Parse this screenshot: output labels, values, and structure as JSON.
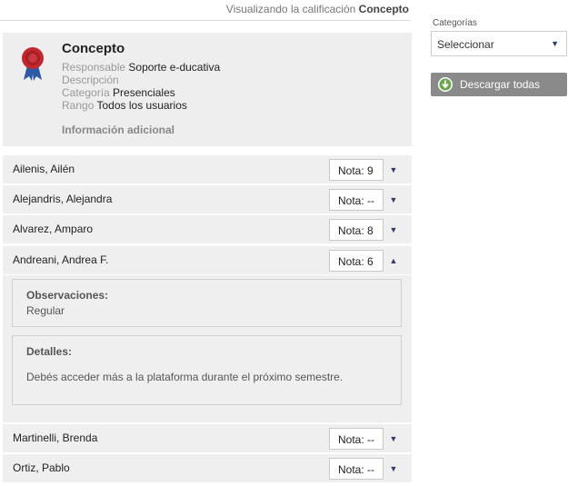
{
  "header": {
    "prefix": "Visualizando la calificación",
    "grade_name": "Concepto"
  },
  "info": {
    "title": "Concepto",
    "responsable_label": "Responsable",
    "responsable_value": "Soporte e-ducativa",
    "descripcion_label": "Descripción",
    "categoria_label": "Categoría",
    "categoria_value": "Presenciales",
    "rango_label": "Rango",
    "rango_value": "Todos los usuarios",
    "additional_info": "Información adicional"
  },
  "students": [
    {
      "name": "Ailenis, Ailén",
      "nota_label": "Nota:",
      "nota": "9",
      "expanded": false
    },
    {
      "name": "Alejandris, Alejandra",
      "nota_label": "Nota:",
      "nota": "--",
      "expanded": false
    },
    {
      "name": "Alvarez, Amparo",
      "nota_label": "Nota:",
      "nota": "8",
      "expanded": false
    },
    {
      "name": "Andreani, Andrea F.",
      "nota_label": "Nota:",
      "nota": "6",
      "expanded": true
    },
    {
      "name": "Martinelli, Brenda",
      "nota_label": "Nota:",
      "nota": "--",
      "expanded": false
    },
    {
      "name": "Ortiz, Pablo",
      "nota_label": "Nota:",
      "nota": "--",
      "expanded": false
    }
  ],
  "details": {
    "observaciones_label": "Observaciones:",
    "observaciones_value": "Regular",
    "detalles_label": "Detalles:",
    "detalles_value": "Debés acceder más a la plataforma durante el próximo semestre."
  },
  "sidebar": {
    "categorias_label": "Categorías",
    "select_value": "Seleccionar",
    "download_label": "Descargar todas"
  },
  "colors": {
    "accent": "#2d3a6b",
    "panel": "#eeeeee",
    "button": "#8a8a8a",
    "download_icon": "#6aa84f"
  },
  "icons": {
    "badge": "award-ribbon-icon",
    "collapsed": "chevron-down-icon",
    "expanded": "chevron-up-icon",
    "download": "download-icon"
  }
}
